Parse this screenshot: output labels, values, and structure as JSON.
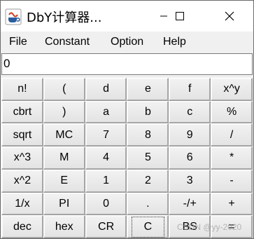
{
  "window": {
    "title": "DbY计算器...",
    "app_icon": "java-coffee-icon"
  },
  "menu": [
    "File",
    "Constant",
    "Option",
    "Help"
  ],
  "display": {
    "value": "0"
  },
  "keys": [
    [
      "n!",
      "(",
      "d",
      "e",
      "f",
      "x^y"
    ],
    [
      "cbrt",
      ")",
      "a",
      "b",
      "c",
      "%"
    ],
    [
      "sqrt",
      "MC",
      "7",
      "8",
      "9",
      "/"
    ],
    [
      "x^3",
      "M",
      "4",
      "5",
      "6",
      "*"
    ],
    [
      "x^2",
      "E",
      "1",
      "2",
      "3",
      "-"
    ],
    [
      "1/x",
      "PI",
      "0",
      ".",
      "-/+",
      "+"
    ],
    [
      "dec",
      "hex",
      "CR",
      "C",
      "BS",
      "="
    ]
  ],
  "focused_key": "C",
  "watermark": "CSDN @yy-2020"
}
